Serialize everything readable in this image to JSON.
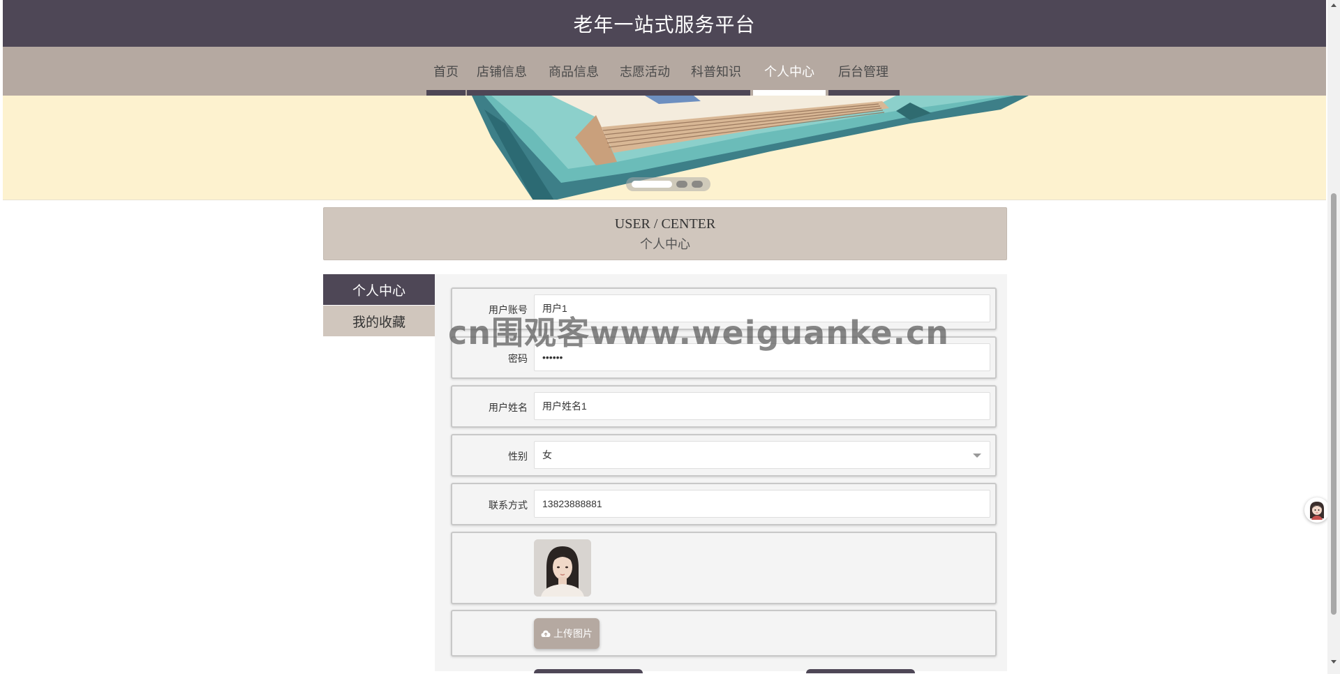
{
  "header": {
    "title": "老年一站式服务平台"
  },
  "nav": {
    "items": [
      {
        "label": "首页"
      },
      {
        "label": "店铺信息"
      },
      {
        "label": "商品信息"
      },
      {
        "label": "志愿活动"
      },
      {
        "label": "科普知识"
      },
      {
        "label": "个人中心"
      },
      {
        "label": "后台管理"
      }
    ],
    "active": "个人中心"
  },
  "banner": {
    "slides": 3,
    "active_slide": 1
  },
  "section": {
    "title_en": "USER / CENTER",
    "title_cn": "个人中心"
  },
  "side_menu": {
    "items": [
      {
        "label": "个人中心"
      },
      {
        "label": "我的收藏"
      }
    ],
    "active": "个人中心"
  },
  "form": {
    "username": {
      "label": "用户账号",
      "value": "用户1"
    },
    "password": {
      "label": "密码",
      "value": "••••••"
    },
    "name": {
      "label": "用户姓名",
      "value": "用户姓名1"
    },
    "gender": {
      "label": "性别",
      "value": "女"
    },
    "phone": {
      "label": "联系方式",
      "value": "13823888881"
    },
    "upload": {
      "label": "上传图片",
      "icon": "cloud-upload-icon"
    }
  },
  "watermark": {
    "text": "cn围观客www.weiguanke.cn"
  },
  "colors": {
    "header": "#4e4756",
    "nav": "#b5a9a1",
    "accent_light": "#d0c6bd",
    "banner_bg": "#fdf2cf"
  }
}
